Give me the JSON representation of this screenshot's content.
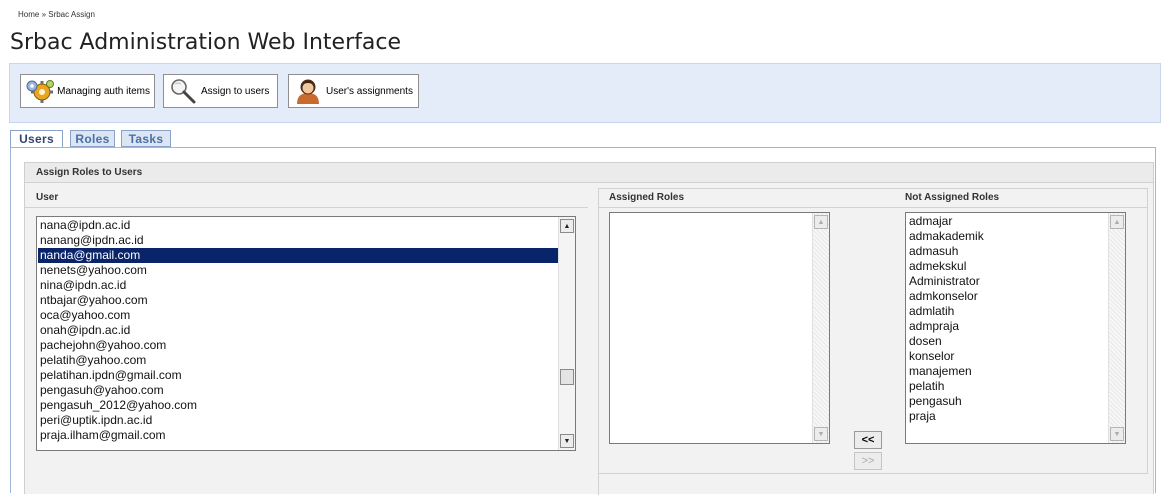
{
  "breadcrumb": "Home » Srbac Assign",
  "page_title": "Srbac Administration Web Interface",
  "toolbar": {
    "buttons": [
      {
        "label": "Managing auth items",
        "icon": "gears-icon"
      },
      {
        "label": "Assign to users",
        "icon": "magnifier-icon"
      },
      {
        "label": "User's assignments",
        "icon": "user-icon"
      }
    ]
  },
  "tabs": [
    {
      "label": "Users",
      "active": true
    },
    {
      "label": "Roles",
      "active": false
    },
    {
      "label": "Tasks",
      "active": false
    }
  ],
  "section_title": "Assign Roles to Users",
  "user_panel": {
    "header": "User",
    "selected": "nanda@gmail.com",
    "users": [
      "nana@ipdn.ac.id",
      "nanang@ipdn.ac.id",
      "nanda@gmail.com",
      "nenets@yahoo.com",
      "nina@ipdn.ac.id",
      "ntbajar@yahoo.com",
      "oca@yahoo.com",
      "onah@ipdn.ac.id",
      "pachejohn@yahoo.com",
      "pelatih@yahoo.com",
      "pelatihan.ipdn@gmail.com",
      "pengasuh@yahoo.com",
      "pengasuh_2012@yahoo.com",
      "peri@uptik.ipdn.ac.id",
      "praja.ilham@gmail.com"
    ]
  },
  "assigned_panel": {
    "header": "Assigned Roles",
    "roles": []
  },
  "not_assigned_panel": {
    "header": "Not Assigned Roles",
    "roles": [
      "admajar",
      "admakademik",
      "admasuh",
      "admekskul",
      "Administrator",
      "admkonselor",
      "admlatih",
      "admpraja",
      "dosen",
      "konselor",
      "manajemen",
      "pelatih",
      "pengasuh",
      "praja"
    ]
  },
  "move_buttons": {
    "assign_label": "<<",
    "revoke_label": ">>"
  },
  "colors": {
    "selection": "#0a246a",
    "toolbar_bg": "#e5ecf9",
    "tab_text": "#4a6fa3"
  }
}
